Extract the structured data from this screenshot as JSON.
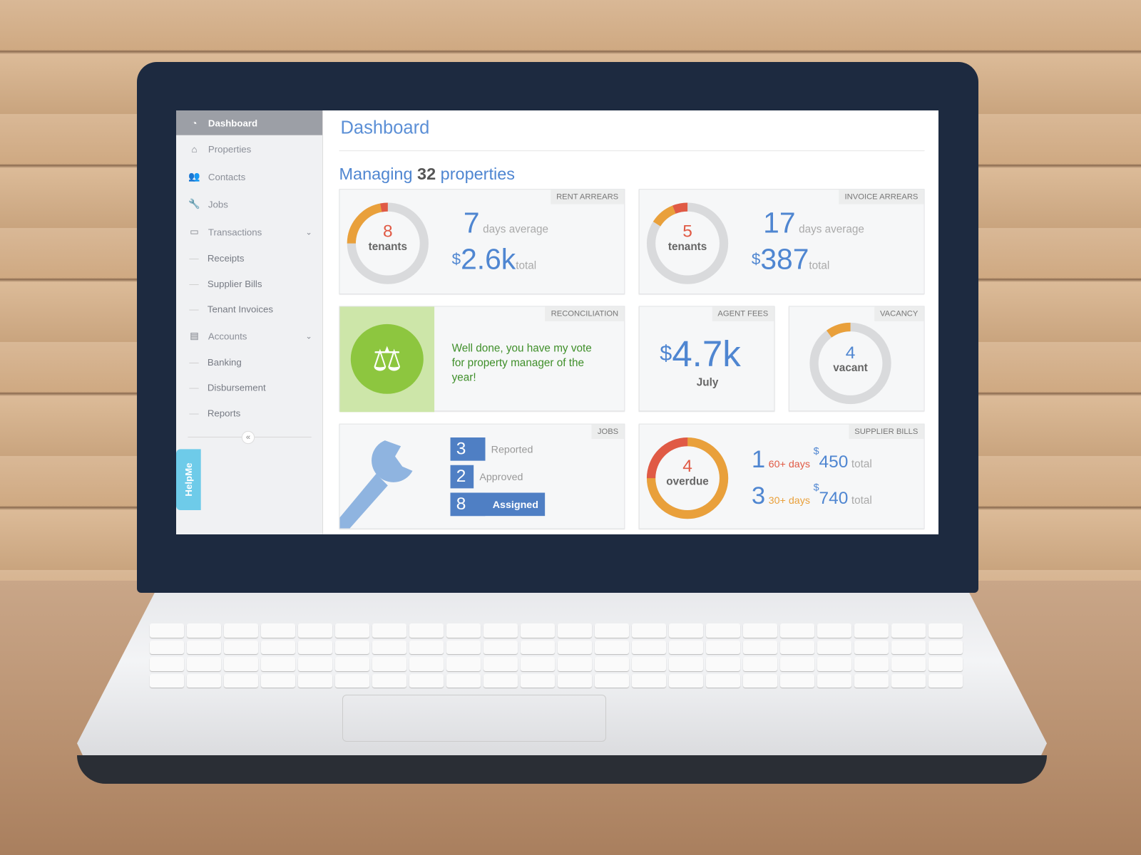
{
  "sidebar": {
    "items": [
      {
        "label": "Dashboard",
        "icon": "dashboard-icon",
        "active": true
      },
      {
        "label": "Properties",
        "icon": "home-icon"
      },
      {
        "label": "Contacts",
        "icon": "users-icon"
      },
      {
        "label": "Jobs",
        "icon": "wrench-icon"
      },
      {
        "label": "Transactions",
        "icon": "money-icon",
        "expandable": true
      },
      {
        "label": "Receipts",
        "sub": true
      },
      {
        "label": "Supplier Bills",
        "sub": true
      },
      {
        "label": "Tenant Invoices",
        "sub": true
      },
      {
        "label": "Accounts",
        "icon": "book-icon",
        "expandable": true
      },
      {
        "label": "Banking",
        "sub": true
      },
      {
        "label": "Disbursement",
        "sub": true
      },
      {
        "label": "Reports",
        "sub": true
      }
    ],
    "collapse": "«",
    "help": "HelpMe"
  },
  "header": {
    "title": "Dashboard"
  },
  "summary": {
    "prefix": "Managing",
    "count": "32",
    "suffix": "properties"
  },
  "colors": {
    "accent": "#4f86d1",
    "red": "#e05a45",
    "orange": "#e9a03b",
    "gray": "#d9dadc",
    "green": "#8dc63f",
    "dark_green": "#3f8f2a"
  },
  "rent_arrears": {
    "tag": "RENT ARREARS",
    "count": "8",
    "count_label": "tenants",
    "days": "7",
    "days_label": "days average",
    "currency": "$",
    "amount": "2.6k",
    "amount_label": "total",
    "segments": {
      "red": 0.03,
      "orange": 0.22
    }
  },
  "invoice_arrears": {
    "tag": "INVOICE ARREARS",
    "count": "5",
    "count_label": "tenants",
    "days": "17",
    "days_label": "days average",
    "currency": "$",
    "amount": "387",
    "amount_label": "total",
    "segments": {
      "red": 0.06,
      "orange": 0.1
    }
  },
  "reconciliation": {
    "tag": "RECONCILIATION",
    "message": "Well done, you have my vote for property manager of the year!"
  },
  "agent_fees": {
    "tag": "AGENT FEES",
    "currency": "$",
    "amount": "4.7k",
    "period": "July"
  },
  "vacancy": {
    "tag": "VACANCY",
    "count": "4",
    "label": "vacant",
    "segments": {
      "red": 0,
      "orange": 0.1
    }
  },
  "jobs": {
    "tag": "JOBS",
    "items": [
      {
        "count": "3",
        "label": "Reported"
      },
      {
        "count": "2",
        "label": "Approved"
      },
      {
        "count": "8",
        "label": "Assigned"
      }
    ]
  },
  "supplier_bills": {
    "tag": "SUPPLIER BILLS",
    "count": "4",
    "count_label": "overdue",
    "segments": {
      "red": 0.25,
      "orange": 0.75
    },
    "rows": [
      {
        "count": "1",
        "age": "60+ days",
        "currency": "$",
        "amount": "450",
        "label": "total"
      },
      {
        "count": "3",
        "age": "30+ days",
        "currency": "$",
        "amount": "740",
        "label": "total"
      }
    ]
  }
}
